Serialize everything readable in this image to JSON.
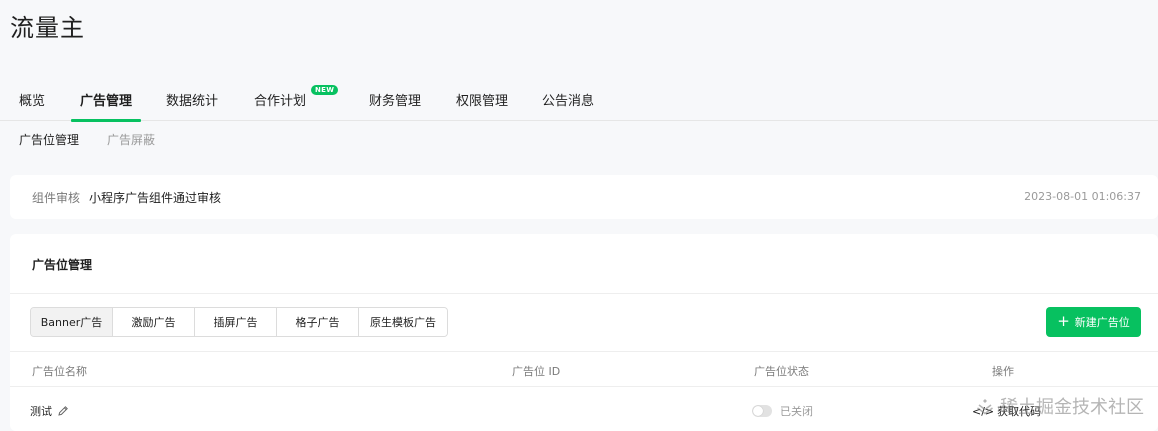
{
  "header": {
    "title": "流量主"
  },
  "main_tabs": [
    {
      "label": "概览",
      "active": false
    },
    {
      "label": "广告管理",
      "active": true
    },
    {
      "label": "数据统计",
      "active": false
    },
    {
      "label": "合作计划",
      "active": false,
      "badge": "NEW"
    },
    {
      "label": "财务管理",
      "active": false
    },
    {
      "label": "权限管理",
      "active": false
    },
    {
      "label": "公告消息",
      "active": false
    }
  ],
  "sub_tabs": [
    {
      "label": "广告位管理",
      "active": true
    },
    {
      "label": "广告屏蔽",
      "active": false
    }
  ],
  "notice": {
    "label": "组件审核",
    "text": "小程序广告组件通过审核",
    "time": "2023-08-01 01:06:37"
  },
  "ad_manage": {
    "title": "广告位管理",
    "types": [
      {
        "label": "Banner广告",
        "selected": true
      },
      {
        "label": "激励广告",
        "selected": false
      },
      {
        "label": "插屏广告",
        "selected": false
      },
      {
        "label": "格子广告",
        "selected": false
      },
      {
        "label": "原生模板广告",
        "selected": false
      }
    ],
    "new_button": "新建广告位",
    "columns": [
      "广告位名称",
      "广告位 ID",
      "广告位状态",
      "操作"
    ],
    "rows": [
      {
        "name": "测试",
        "id": "",
        "status": "已关闭",
        "action": "获取代码"
      }
    ]
  },
  "watermark": "稀土掘金技术社区",
  "colors": {
    "accent": "#07c160",
    "background": "#f7f8fa"
  }
}
